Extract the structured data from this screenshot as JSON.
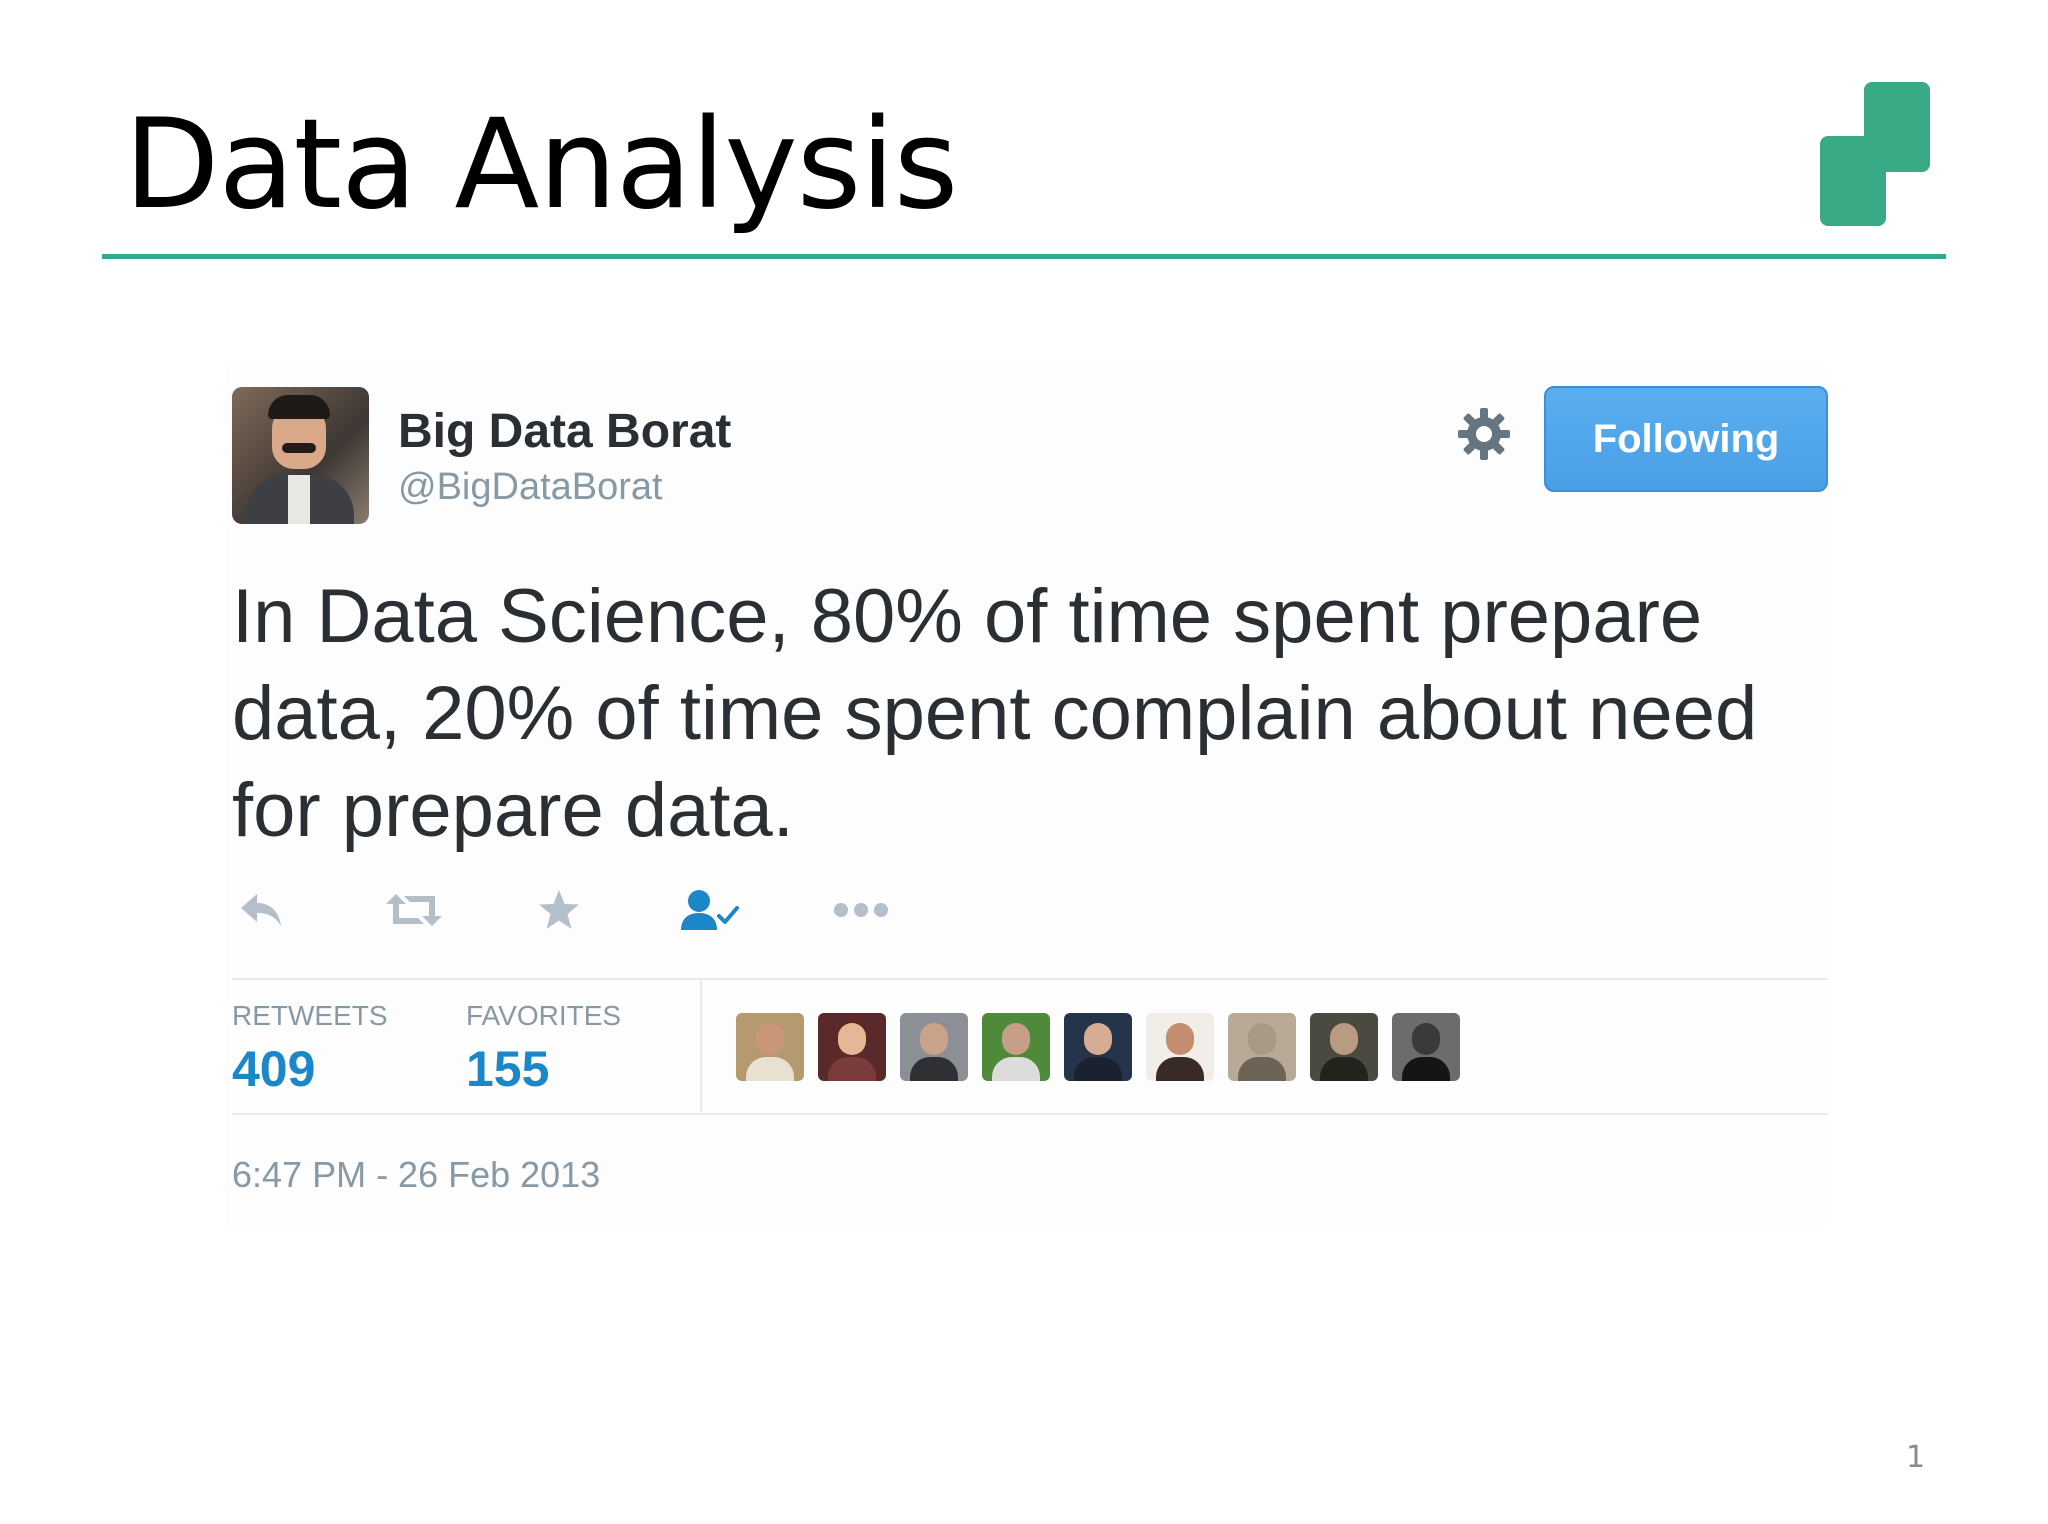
{
  "slide": {
    "title": "Data Analysis",
    "page_number": "1",
    "accent_color": "#35a890",
    "logo_color": "#38aa86"
  },
  "tweet": {
    "user_name": "Big Data Borat",
    "user_handle": "@BigDataBorat",
    "follow_button_label": "Following",
    "text": "In Data Science, 80% of time spent prepare data, 20% of time spent complain about need for prepare data.",
    "actions": [
      {
        "name": "reply",
        "icon": "reply-icon"
      },
      {
        "name": "retweet",
        "icon": "retweet-icon"
      },
      {
        "name": "favorite",
        "icon": "star-icon"
      },
      {
        "name": "follow-user",
        "icon": "user-check-icon"
      },
      {
        "name": "more",
        "icon": "more-icon"
      }
    ],
    "stats": {
      "retweets_label": "RETWEETS",
      "retweets_value": "409",
      "favorites_label": "FAVORITES",
      "favorites_value": "155"
    },
    "favoriters_count_shown": 9,
    "timestamp": "6:47 PM - 26 Feb 2013",
    "colors": {
      "follow_button": "#55acee",
      "stat_value": "#1b86c8",
      "muted_text": "#8899a6",
      "body_text": "#292f33"
    }
  }
}
